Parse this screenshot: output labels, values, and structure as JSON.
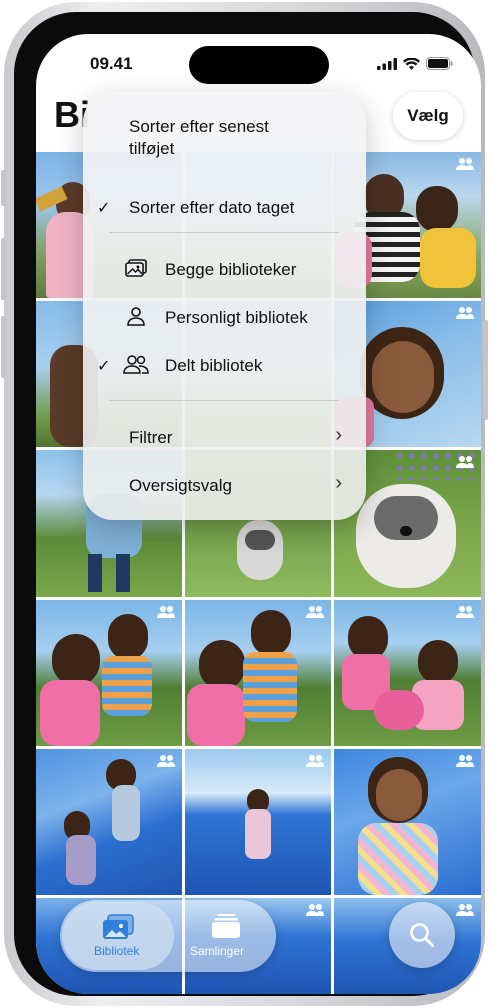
{
  "status": {
    "time": "09.41"
  },
  "header": {
    "title": "Bi",
    "select_label": "Vælg"
  },
  "menu": {
    "sort_recent": "Sorter efter senest\ntilføjet",
    "sort_date": "Sorter efter dato taget",
    "both_libraries": "Begge biblioteker",
    "personal_library": "Personligt bibliotek",
    "shared_library": "Delt bibliotek",
    "filter": "Filtrer",
    "view_options": "Oversigtsvalg",
    "check": "✓",
    "chevron": "›"
  },
  "tabs": {
    "library": "Bibliotek",
    "collections": "Samlinger"
  },
  "colors": {
    "accent": "#2f7fdc",
    "menu_bg": "#f2f3f5",
    "text": "#111111"
  }
}
